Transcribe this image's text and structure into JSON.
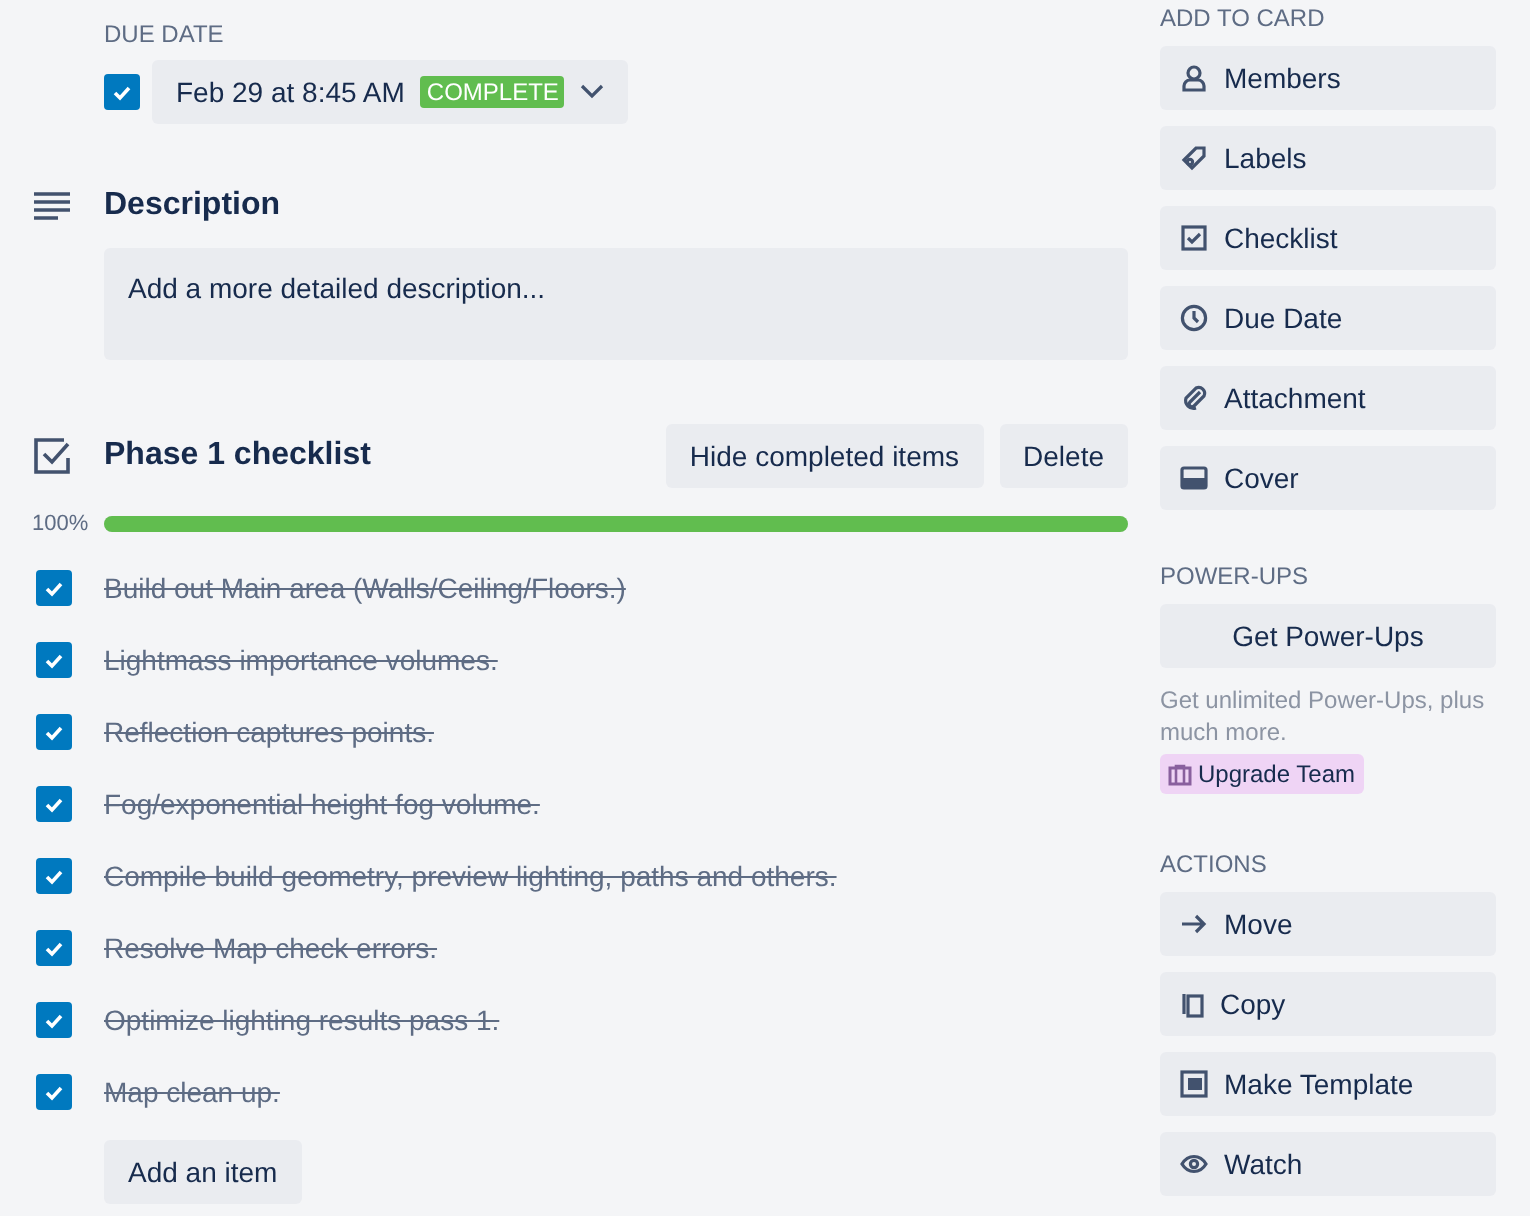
{
  "due_date": {
    "label": "DUE DATE",
    "checked": true,
    "date": "Feb 29 at 8:45 AM",
    "status": "COMPLETE"
  },
  "description": {
    "title": "Description",
    "placeholder": "Add a more detailed description..."
  },
  "checklist": {
    "title": "Phase 1 checklist",
    "buttons": [
      "Hide completed items",
      "Delete"
    ],
    "percent": "100%",
    "level": 1,
    "items": [
      {
        "text": "Build out Main area (Walls/Ceiling/Floors.)",
        "checked": true
      },
      {
        "text": "Lightmass importance volumes.",
        "checked": true
      },
      {
        "text": "Reflection captures points.",
        "checked": true
      },
      {
        "text": "Fog/exponential height fog volume.",
        "checked": true
      },
      {
        "text": "Compile build geometry, preview lighting, paths and others.",
        "checked": true
      },
      {
        "text": "Resolve Map check errors.",
        "checked": true
      },
      {
        "text": "Optimize lighting results pass 1.",
        "checked": true
      },
      {
        "text": "Map clean up.",
        "checked": true
      }
    ],
    "add_button": "Add an item"
  },
  "sidebar": {
    "add_to_card": {
      "title": "ADD TO CARD",
      "buttons": [
        "Members",
        "Labels",
        "Checklist",
        "Due Date",
        "Attachment",
        "Cover"
      ]
    },
    "power_ups": {
      "title": "POWER-UPS",
      "button": "Get Power-Ups",
      "note": "Get unlimited Power-Ups, plus much more.",
      "upgrade": "Upgrade Team"
    },
    "actions": {
      "title": "ACTIONS",
      "buttons": [
        "Move",
        "Copy",
        "Make Template",
        "Watch"
      ]
    }
  }
}
